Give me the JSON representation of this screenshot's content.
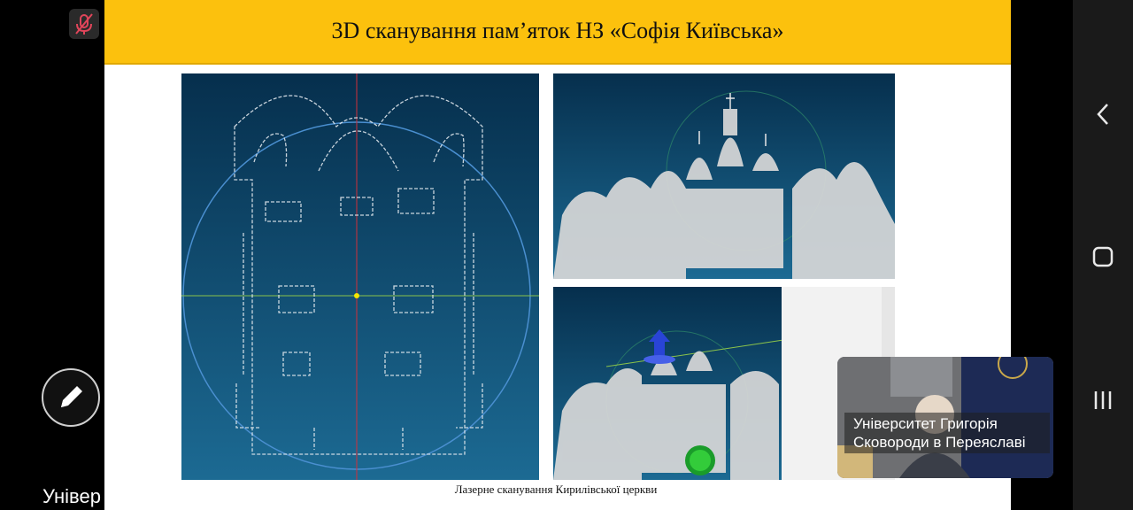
{
  "slide": {
    "title": "3D сканування пам’яток НЗ «Софія Київська»",
    "caption": "Лазерне сканування Кирилівської церкви"
  },
  "video": {
    "participant_name": "Університет Григорія Сковороди в Переяславі"
  },
  "overlay": {
    "bottom_text": "Універ"
  },
  "icons": {
    "mic": "mic-off-icon",
    "edit": "pencil-icon",
    "back": "chevron-left-icon",
    "home": "square-icon",
    "recents": "three-bars-icon"
  },
  "colors": {
    "header": "#fcc10d",
    "scan_bg_top": "#062f4d",
    "scan_bg_bottom": "#1c6a93",
    "mic_red": "#e0455a"
  }
}
